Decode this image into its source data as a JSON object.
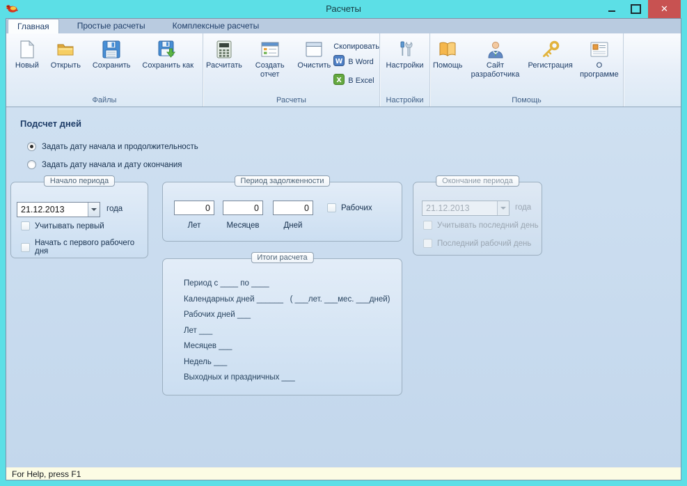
{
  "window": {
    "title": "Расчеты",
    "controls": {
      "minimize": "minimize",
      "maximize": "maximize",
      "close_glyph": "✕"
    },
    "colors": {
      "frame": "#5cdfe6",
      "close_button": "#c85251",
      "client": "#c7daee",
      "status": "#fcfce4"
    }
  },
  "tabs": [
    {
      "label": "Главная",
      "active": true
    },
    {
      "label": "Простые расчеты",
      "active": false
    },
    {
      "label": "Комплексные расчеты",
      "active": false
    }
  ],
  "ribbon": {
    "groups": [
      {
        "caption": "Файлы",
        "buttons": [
          {
            "label": "Новый",
            "icon": "new-document-icon"
          },
          {
            "label": "Открыть",
            "icon": "open-folder-icon"
          },
          {
            "label": "Сохранить",
            "icon": "save-icon"
          },
          {
            "label": "Сохранить как",
            "icon": "save-as-icon"
          }
        ]
      },
      {
        "caption": "Расчеты",
        "buttons": [
          {
            "label": "Расчитать",
            "icon": "calculator-icon"
          },
          {
            "label": "Создать отчет",
            "icon": "report-icon"
          },
          {
            "label": "Очистить",
            "icon": "clear-form-icon"
          }
        ],
        "copy": {
          "label": "Скопировать",
          "items": [
            {
              "label": "В Word",
              "icon": "word-icon"
            },
            {
              "label": "В Excel",
              "icon": "excel-icon"
            }
          ]
        }
      },
      {
        "caption": "Настройки",
        "buttons": [
          {
            "label": "Настройки",
            "icon": "tools-icon"
          }
        ]
      },
      {
        "caption": "Помощь",
        "buttons": [
          {
            "label": "Помощь",
            "icon": "help-book-icon"
          },
          {
            "label": "Сайт разработчика",
            "icon": "developer-site-icon"
          },
          {
            "label": "Регистрация",
            "icon": "key-icon"
          },
          {
            "label": "О программе",
            "icon": "about-icon"
          }
        ]
      }
    ]
  },
  "main": {
    "heading": "Подсчет дней",
    "radios": [
      {
        "label": "Задать дату начала и продолжительность",
        "selected": true
      },
      {
        "label": "Задать дату начала и дату окончания",
        "selected": false
      }
    ],
    "period_start": {
      "caption": "Начало периода",
      "date_value": "21.12.2013",
      "date_suffix": "года",
      "checkboxes": [
        {
          "label": "Учитывать первый",
          "checked": false
        },
        {
          "label": "Начать с первого рабочего дня",
          "checked": false
        }
      ]
    },
    "debt_period": {
      "caption": "Период задолженности",
      "fields": [
        {
          "value": "0",
          "label": "Лет"
        },
        {
          "value": "0",
          "label": "Месяцев"
        },
        {
          "value": "0",
          "label": "Дней"
        }
      ],
      "checkbox": {
        "label": "Рабочих",
        "checked": false
      }
    },
    "period_end": {
      "caption": "Окончание периода",
      "disabled": true,
      "date_value": "21.12.2013",
      "date_suffix": "года",
      "checkboxes": [
        {
          "label": "Учитывать последний день",
          "checked": false
        },
        {
          "label": "Последний рабочий день",
          "checked": false
        }
      ]
    },
    "results": {
      "caption": "Итоги расчета",
      "lines": [
        "Период с ____ по ____",
        "Календарных дней ______   ( ___лет. ___мес. ___дней)",
        "Рабочих дней ___",
        "Лет ___",
        "Месяцев ___",
        "Недель ___",
        "Выходных и праздничных ___"
      ]
    }
  },
  "statusbar": {
    "text": "For Help, press F1"
  }
}
